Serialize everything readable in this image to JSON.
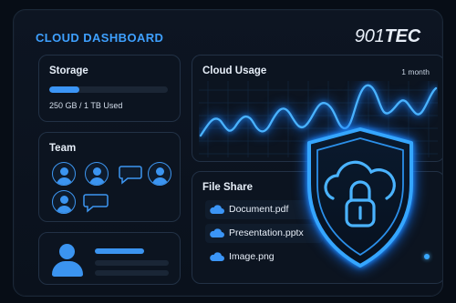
{
  "header": {
    "title": "CLOUD DASHBOARD",
    "brand_prefix": "901",
    "brand_suffix": "TEC"
  },
  "storage": {
    "title": "Storage",
    "used_text": "250 GB / 1 TB Used",
    "usage_fraction": 0.25
  },
  "team": {
    "title": "Team",
    "members": [
      {
        "icon": "person-icon"
      },
      {
        "icon": "person-icon"
      },
      {
        "icon": "chat-icon"
      },
      {
        "icon": "person-icon"
      },
      {
        "icon": "person-icon"
      },
      {
        "icon": "chat-icon"
      }
    ]
  },
  "profile": {
    "icon": "user-avatar-icon"
  },
  "usage": {
    "title": "Cloud Usage",
    "period": "1 month"
  },
  "files": {
    "title": "File Share",
    "items": [
      {
        "name": "Document.pdf",
        "icon": "cloud-icon"
      },
      {
        "name": "Presentation.pptx",
        "icon": "cloud-icon"
      },
      {
        "name": "Image.png",
        "icon": "cloud-icon"
      }
    ]
  },
  "security": {
    "icon": "shield-cloud-lock-icon"
  },
  "colors": {
    "accent": "#3ea0ff",
    "background": "#070d16",
    "card_border": "#223145"
  }
}
